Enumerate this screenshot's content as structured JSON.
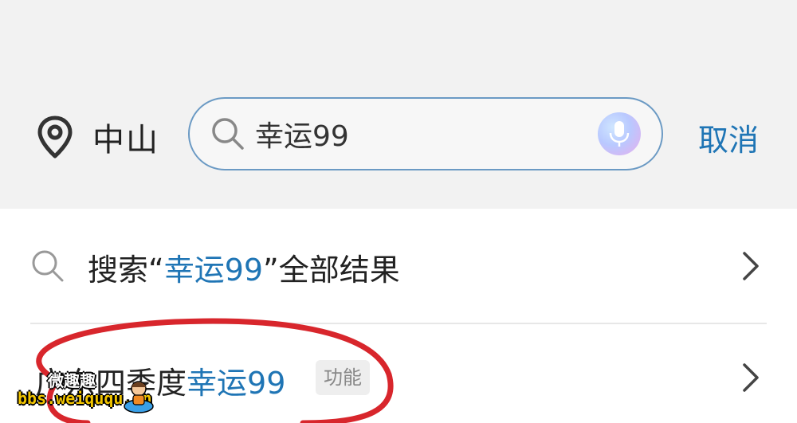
{
  "header": {
    "location_label": "中山",
    "search_value": "幸运99",
    "cancel_label": "取消"
  },
  "suggestions": {
    "all_results": {
      "prefix": "搜索“",
      "keyword": "幸运99",
      "suffix": "”全部结果"
    },
    "item": {
      "prefix": "广东四季度",
      "keyword": "幸运99",
      "tag": "功能"
    }
  },
  "watermark": {
    "top_text": "微趣趣",
    "bottom_text": "bbs.weiququ.cn"
  },
  "colors": {
    "accent": "#1f75b5",
    "header_bg": "#f2f2f2",
    "annotation": "#d8262c"
  }
}
